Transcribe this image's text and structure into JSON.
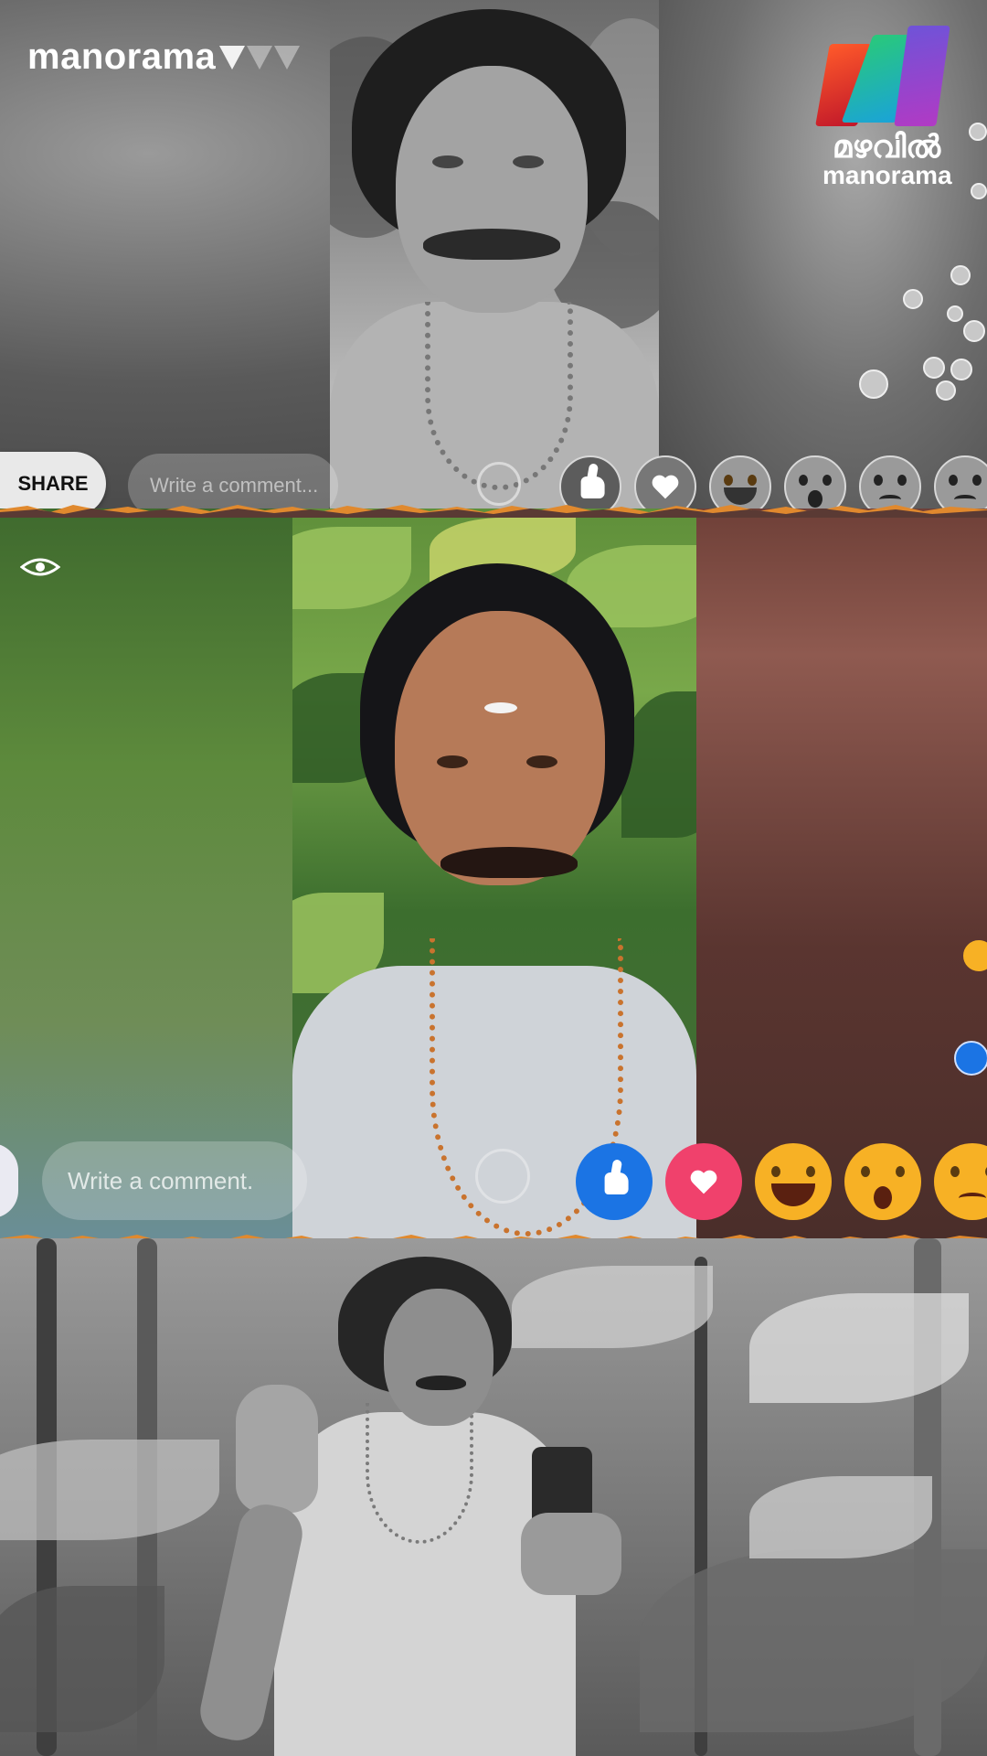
{
  "branding": {
    "channel_left": "manorama",
    "channel_right_ml": "മഴവിൽ",
    "channel_right_en": "manorama"
  },
  "top_panel": {
    "share_label": "SHARE",
    "comment_placeholder": "Write a comment...",
    "reactions": [
      "like-icon",
      "love-icon",
      "haha-icon",
      "wow-icon",
      "sad-icon",
      "angry-icon"
    ]
  },
  "middle_panel": {
    "comment_placeholder": "Write a comment.",
    "reactions": [
      "like-icon",
      "love-icon",
      "haha-icon",
      "wow-icon",
      "sad-icon"
    ],
    "colors": {
      "like": "#1b74e4",
      "love": "#f0416c",
      "emoji": "#f7b125"
    }
  }
}
